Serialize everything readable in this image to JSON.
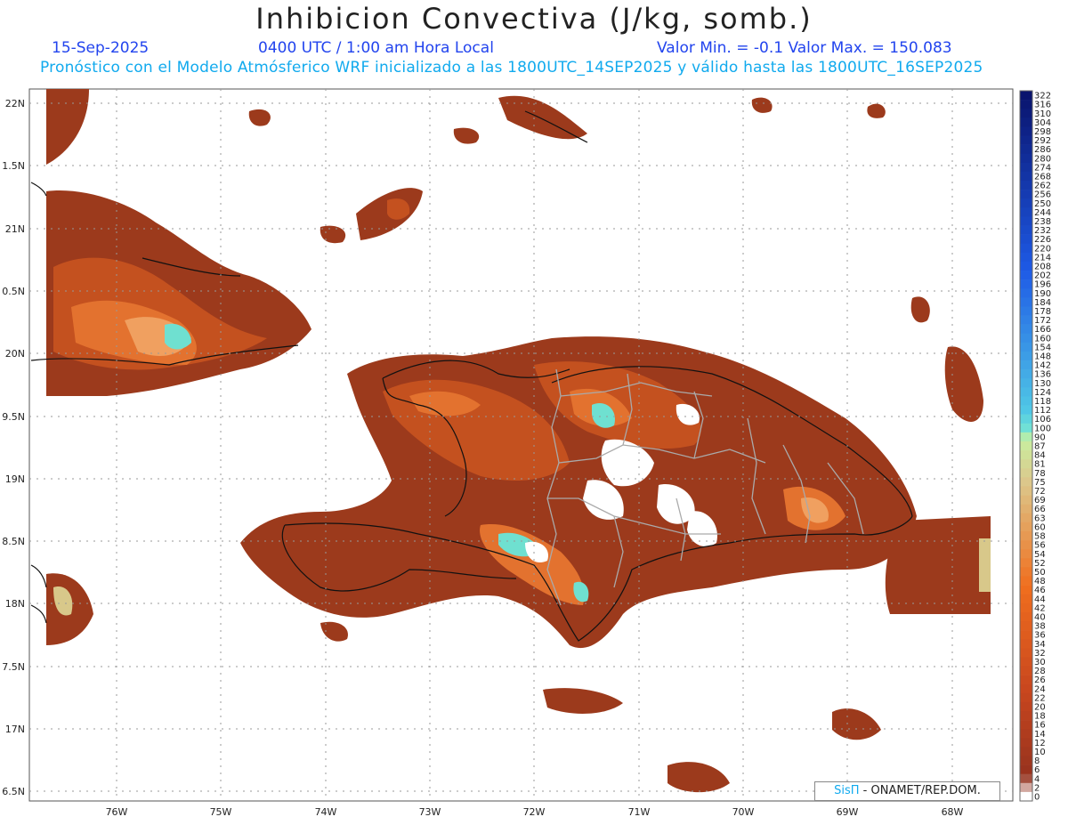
{
  "title": "Inhibicion Convectiva (J/kg, somb.)",
  "date": "15-Sep-2025",
  "time": "0400 UTC / 1:00 am Hora Local",
  "minmax": "Valor Min. = -0.1  Valor Max. = 150.083",
  "model_line": "Pronóstico con el Modelo Atmósferico WRF inicializado a las 1800UTC_14SEP2025 y válido hasta las  1800UTC_16SEP2025",
  "credit_prefix": "SisΠ",
  "credit_suffix": " - ONAMET/REP.DOM.",
  "lat_labels": [
    "22N",
    "1.5N",
    "21N",
    "0.5N",
    "20N",
    "9.5N",
    "19N",
    "8.5N",
    "18N",
    "7.5N",
    "17N",
    "6.5N"
  ],
  "lon_labels": [
    "76W",
    "75W",
    "74W",
    "73W",
    "72W",
    "71W",
    "70W",
    "69W",
    "68W"
  ],
  "colorbar_labels": [
    "322",
    "316",
    "310",
    "304",
    "298",
    "292",
    "286",
    "280",
    "274",
    "268",
    "262",
    "256",
    "250",
    "244",
    "238",
    "232",
    "226",
    "220",
    "214",
    "208",
    "202",
    "196",
    "190",
    "184",
    "178",
    "172",
    "166",
    "160",
    "154",
    "148",
    "142",
    "136",
    "130",
    "124",
    "118",
    "112",
    "106",
    "100",
    "90",
    "87",
    "84",
    "81",
    "78",
    "75",
    "72",
    "69",
    "66",
    "63",
    "60",
    "58",
    "56",
    "54",
    "52",
    "50",
    "48",
    "46",
    "44",
    "42",
    "40",
    "38",
    "36",
    "34",
    "32",
    "30",
    "28",
    "26",
    "24",
    "22",
    "20",
    "18",
    "16",
    "14",
    "12",
    "10",
    "8",
    "6",
    "4",
    "2",
    "0"
  ],
  "colors": {
    "land_base": "#9c3a1c",
    "land_mid": "#c4511f",
    "land_warm": "#e3722f",
    "land_light": "#f0a060",
    "land_pale": "#d8c88a",
    "land_cyan": "#6fe0d0",
    "coast": "#111111",
    "provinces": "#aaaaaa"
  }
}
